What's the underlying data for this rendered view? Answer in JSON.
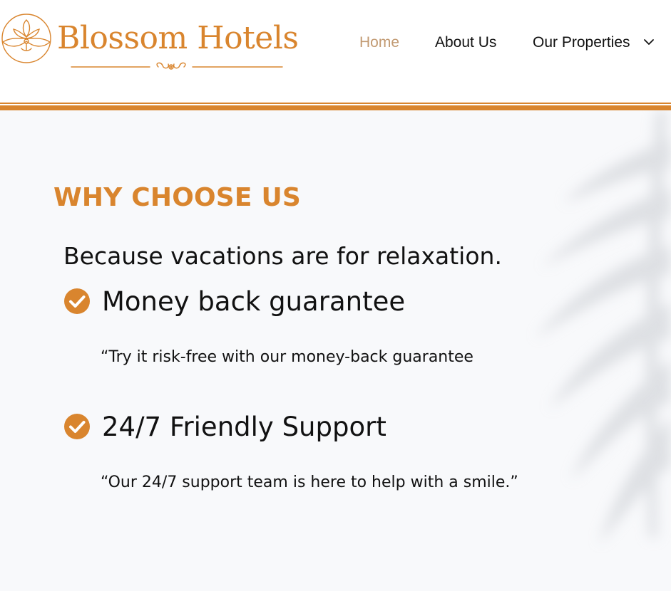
{
  "brand": {
    "name": "Blossom Hotels",
    "color": "#d9852e"
  },
  "nav": {
    "items": [
      {
        "label": "Home",
        "active": true
      },
      {
        "label": "About Us",
        "active": false
      },
      {
        "label": "Our Properties",
        "active": false
      }
    ],
    "active_color": "#c29a72",
    "dropdown_icon": "chevron-down-icon"
  },
  "section": {
    "title": "WHY CHOOSE US",
    "subtitle": "Because vacations are for relaxation.",
    "features": [
      {
        "icon": "check-circle-icon",
        "title": "Money back guarantee",
        "description": "“Try it risk-free with our money-back guarantee"
      },
      {
        "icon": "check-circle-icon",
        "title": "24/7 Friendly Support",
        "description": "“Our 24/7 support team is here to help with a smile.”"
      }
    ]
  },
  "colors": {
    "accent": "#d9852e",
    "background": "#f8f9fb",
    "text": "#111111"
  }
}
